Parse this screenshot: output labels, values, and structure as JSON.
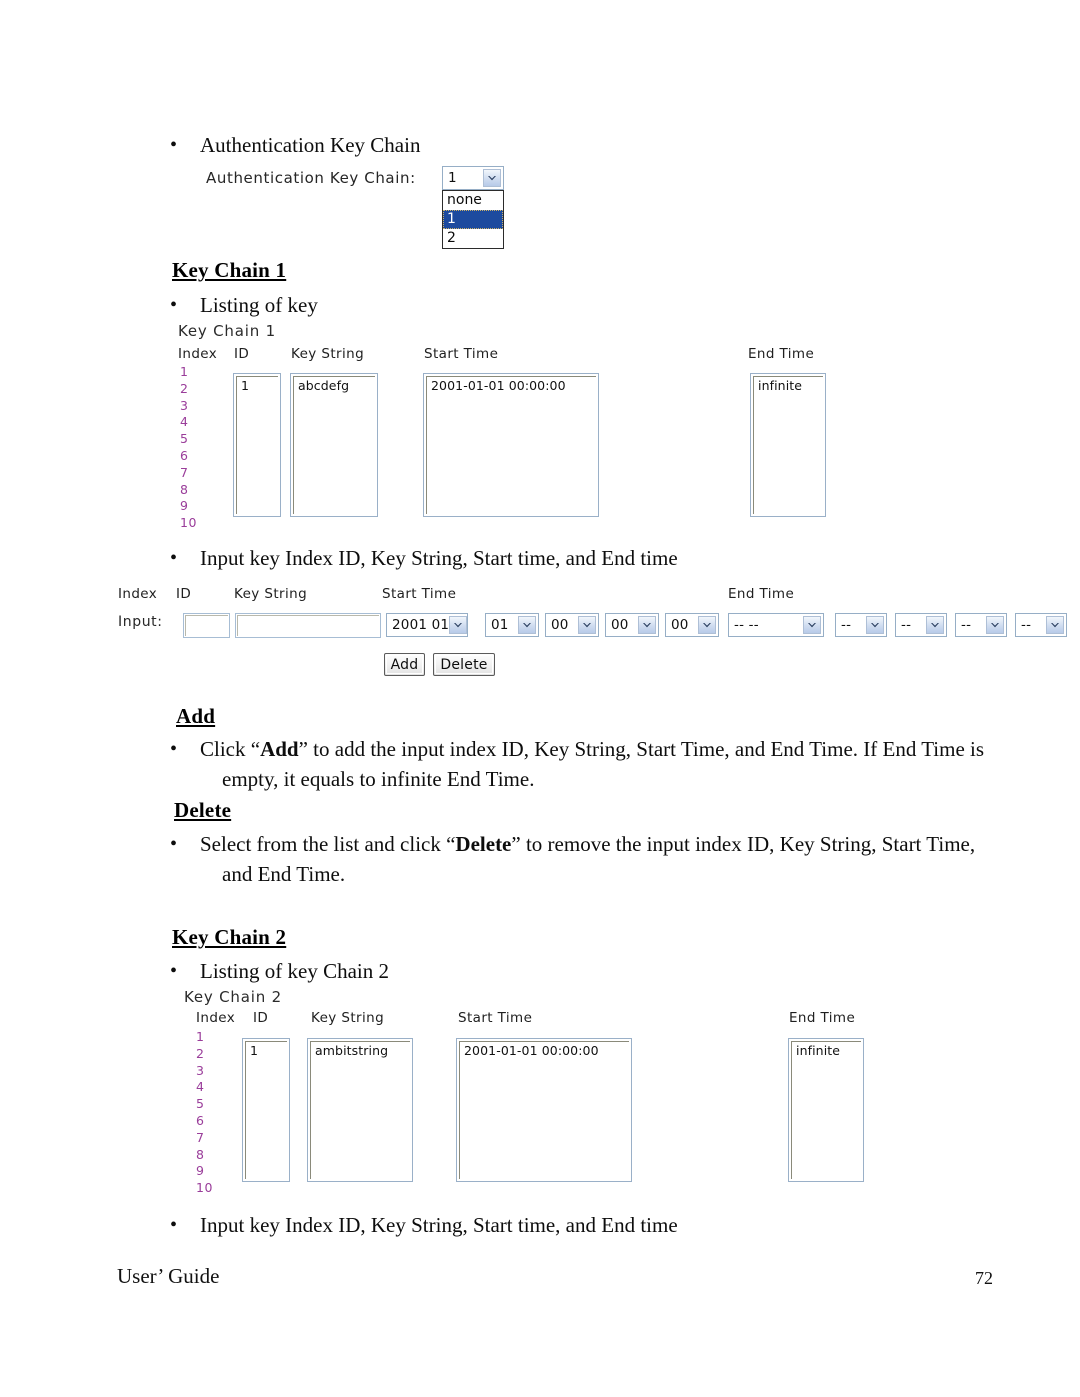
{
  "document": {
    "footer": {
      "left": "User’ Guide",
      "page_number": "72"
    }
  },
  "section_auth": {
    "bullet": "Authentication Key Chain",
    "bullet_marker": "•",
    "widget": {
      "label": "Authentication Key Chain:",
      "selected_value": "1",
      "options": [
        "none",
        "1",
        "2"
      ],
      "highlighted_option": "1",
      "highlight_color": "#1c4a9e"
    }
  },
  "section_keychain1": {
    "heading": "Key Chain 1",
    "bullet_listing": "Listing of key",
    "bullet_marker": "•",
    "panel": {
      "title": "Key Chain 1",
      "columns": [
        "Index",
        "ID",
        "Key String",
        "Start Time",
        "End Time"
      ],
      "index_values": [
        "1",
        "2",
        "3",
        "4",
        "5",
        "6",
        "7",
        "8",
        "9",
        "10"
      ],
      "index_color": "#9a3d9a",
      "rows": [
        {
          "id": "1",
          "key_string": "abcdefg",
          "start_time": "2001-01-01 00:00:00",
          "end_time": "infinite"
        }
      ]
    },
    "bullet_input": "Input key Index ID, Key String, Start time, and End time",
    "input_form": {
      "columns": [
        "Index",
        "ID",
        "Key String",
        "Start Time",
        "End Time"
      ],
      "row_label": "Input:",
      "id_value": "",
      "id_placeholder": "",
      "key_string_value": "",
      "key_string_placeholder": "",
      "start_time_selects": [
        "2001 01",
        "01",
        "00",
        "00",
        "00"
      ],
      "end_time_selects": [
        "-- --",
        "--",
        "--",
        "--",
        "--"
      ],
      "buttons": {
        "add": "Add",
        "delete": "Delete"
      }
    }
  },
  "section_add": {
    "heading": "Add",
    "bullet_marker": "•",
    "text_part1": "Click “",
    "text_bold1": "Add",
    "text_part2": "” to add the input index ID, Key String, Start Time, and End Time. If End Time is",
    "text_line2": "empty, it equals to infinite End Time."
  },
  "section_delete": {
    "heading": "Delete",
    "bullet_marker": "•",
    "text_part1": "Select from the list and click “",
    "text_bold1": "Delete",
    "text_part2": "” to remove the input index ID, Key String, Start Time,",
    "text_line2": "and End Time."
  },
  "section_keychain2": {
    "heading": "Key Chain 2",
    "bullet_listing": "Listing of key Chain 2",
    "bullet_marker": "•",
    "panel": {
      "title": "Key Chain 2",
      "columns": [
        "Index",
        "ID",
        "Key String",
        "Start Time",
        "End Time"
      ],
      "index_values": [
        "1",
        "2",
        "3",
        "4",
        "5",
        "6",
        "7",
        "8",
        "9",
        "10"
      ],
      "index_color": "#9a3d9a",
      "rows": [
        {
          "id": "1",
          "key_string": "ambitstring",
          "start_time": "2001-01-01 00:00:00",
          "end_time": "infinite"
        }
      ]
    },
    "bullet_input": "Input key Index ID, Key String, Start time, and End time"
  }
}
